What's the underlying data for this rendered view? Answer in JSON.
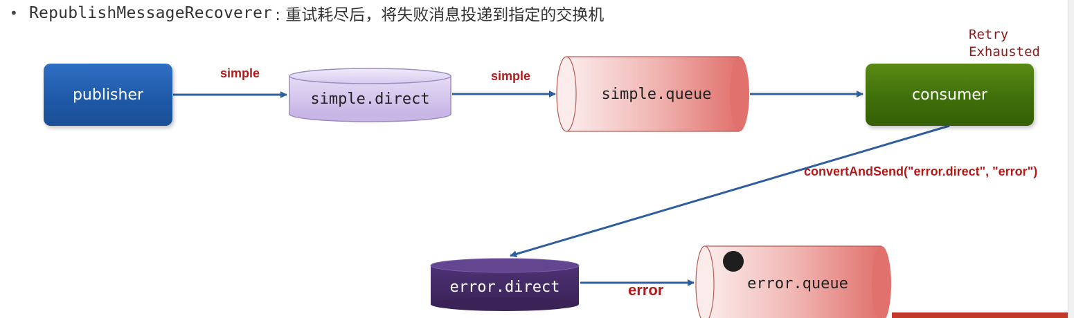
{
  "header": {
    "bullet": "•",
    "code": "RepublishMessageRecoverer",
    "description": ": 重试耗尽后，将失败消息投递到指定的交换机"
  },
  "nodes": {
    "publisher": "publisher",
    "simple_direct": "simple.direct",
    "simple_queue": "simple.queue",
    "consumer": "consumer",
    "error_direct": "error.direct",
    "error_queue": "error.queue"
  },
  "edges": {
    "publisher_to_exchange": "simple",
    "exchange_to_queue": "simple",
    "consumer_to_error_exchange": "convertAndSend(\"error.direct\", \"error\")",
    "error_exchange_to_queue": "error"
  },
  "annotations": {
    "retry_exhausted": "Retry\nExhausted"
  },
  "colors": {
    "publisher": "#1f5aa8",
    "consumer": "#3f6f0a",
    "exchange_light": "#d9ccf0",
    "exchange_dark": "#4a2f6e",
    "queue": "#e57f7a",
    "arrow": "#2f5e9e",
    "label_red": "#b31b1b"
  }
}
